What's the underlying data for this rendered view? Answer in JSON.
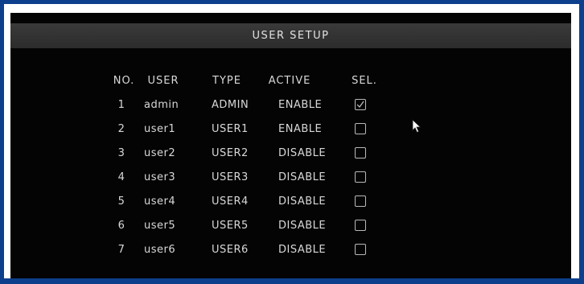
{
  "window": {
    "title": "USER SETUP"
  },
  "table": {
    "headers": {
      "no": "NO.",
      "user": "USER",
      "type": "TYPE",
      "active": "ACTIVE",
      "sel": "SEL."
    },
    "rows": [
      {
        "no": "1",
        "user": "admin",
        "type": "ADMIN",
        "active": "ENABLE",
        "selected": true
      },
      {
        "no": "2",
        "user": "user1",
        "type": "USER1",
        "active": "ENABLE",
        "selected": false
      },
      {
        "no": "3",
        "user": "user2",
        "type": "USER2",
        "active": "DISABLE",
        "selected": false
      },
      {
        "no": "4",
        "user": "user3",
        "type": "USER3",
        "active": "DISABLE",
        "selected": false
      },
      {
        "no": "5",
        "user": "user4",
        "type": "USER4",
        "active": "DISABLE",
        "selected": false
      },
      {
        "no": "6",
        "user": "user5",
        "type": "USER5",
        "active": "DISABLE",
        "selected": false
      },
      {
        "no": "7",
        "user": "user6",
        "type": "USER6",
        "active": "DISABLE",
        "selected": false
      }
    ]
  },
  "colors": {
    "outer_border": "#0d3f8c",
    "window_background": "#040404",
    "titlebar": "#333333",
    "text": "#d8d8d8"
  },
  "icons": {
    "cursor": "mouse-pointer-icon",
    "check": "checkmark-icon"
  }
}
